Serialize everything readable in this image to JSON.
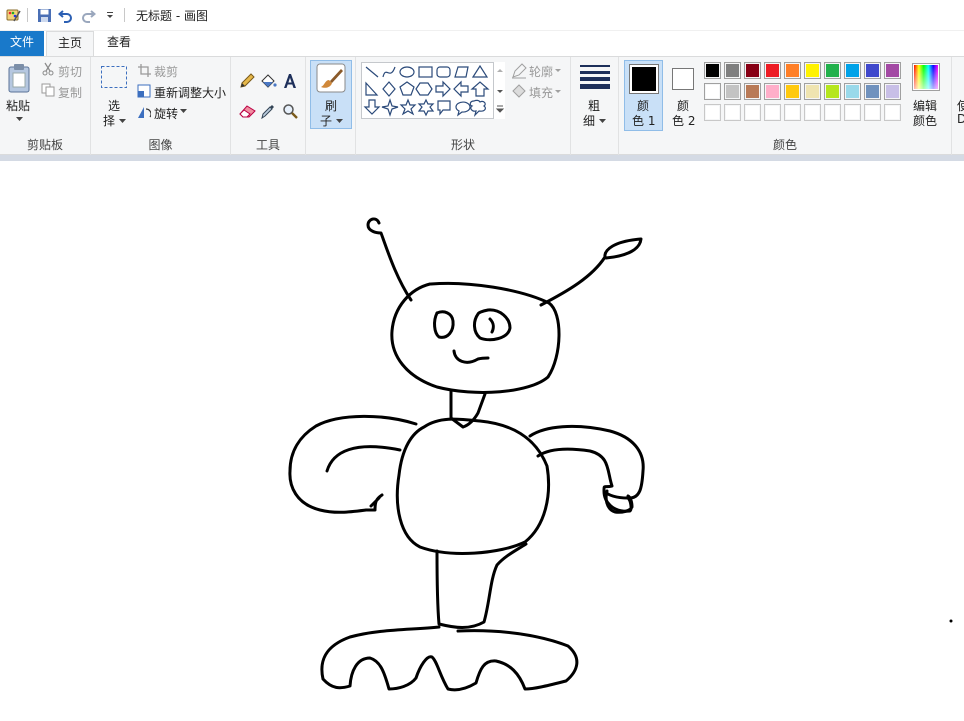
{
  "window": {
    "title": "无标题 - 画图"
  },
  "tabs": {
    "file": "文件",
    "home": "主页",
    "view": "查看"
  },
  "clipboard": {
    "paste": "粘贴",
    "cut": "剪切",
    "copy": "复制",
    "group": "剪贴板"
  },
  "image": {
    "select_1": "选",
    "select_2": "择",
    "crop": "裁剪",
    "resize": "重新调整大小",
    "rotate": "旋转",
    "group": "图像"
  },
  "tools": {
    "group": "工具"
  },
  "brush": {
    "label_1": "刷",
    "label_2": "子"
  },
  "shapes": {
    "outline": "轮廓",
    "fill": "填充",
    "group": "形状"
  },
  "size": {
    "label_1": "粗",
    "label_2": "细"
  },
  "colors": {
    "color1_1": "颜",
    "color1_2": "色 1",
    "color2_1": "颜",
    "color2_2": "色 2",
    "edit_1": "编辑",
    "edit_2": "颜色",
    "group": "颜色",
    "color1_value": "#000000",
    "color2_value": "#ffffff",
    "palette_row1": [
      "#000000",
      "#7f7f7f",
      "#880015",
      "#ed1c24",
      "#ff7f27",
      "#fff200",
      "#22b14c",
      "#00a2e8",
      "#3f48cc",
      "#a349a4"
    ],
    "palette_row2": [
      "#ffffff",
      "#c3c3c3",
      "#b97a57",
      "#ffaec9",
      "#ffc90e",
      "#efe4b0",
      "#b5e61d",
      "#99d9ea",
      "#7092be",
      "#c8bfe7"
    ],
    "palette_row3": [
      "#ffffff",
      "#ffffff",
      "#ffffff",
      "#ffffff",
      "#ffffff",
      "#ffffff",
      "#ffffff",
      "#ffffff",
      "#ffffff",
      "#ffffff"
    ]
  },
  "edge": {
    "label_1": "使",
    "label_2": "D"
  }
}
